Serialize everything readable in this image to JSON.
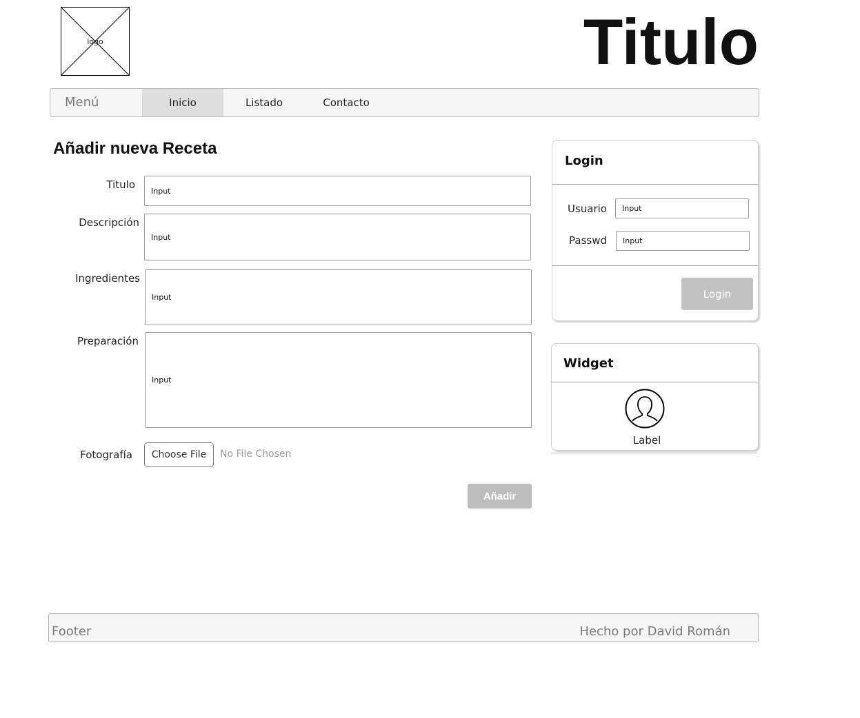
{
  "header": {
    "logo_text": "logo",
    "title": "Titulo"
  },
  "nav": {
    "brand": "Menú",
    "items": [
      {
        "label": "Inicio",
        "active": true
      },
      {
        "label": "Listado",
        "active": false
      },
      {
        "label": "Contacto",
        "active": false
      }
    ]
  },
  "form": {
    "heading": "Añadir nueva Receta",
    "fields": [
      {
        "label": "Titulo",
        "value": "Input"
      },
      {
        "label": "Descripción",
        "value": "Input"
      },
      {
        "label": "Ingredientes",
        "value": "Input"
      },
      {
        "label": "Preparación",
        "value": "Input"
      }
    ],
    "photo": {
      "label": "Fotografía",
      "button": "Choose File",
      "status": "No File Chosen"
    },
    "submit_label": "Añadir"
  },
  "login": {
    "title": "Login",
    "user_label": "Usuario",
    "user_value": "Input",
    "pass_label": "Passwd",
    "pass_value": "Input",
    "button": "Login"
  },
  "widget": {
    "title": "Widget",
    "icon": "user-avatar-icon",
    "label": "Label"
  },
  "footer": {
    "left": "Footer",
    "right": "Hecho por David Román"
  },
  "colors": {
    "nav_bg": "#f6f6f6",
    "nav_active": "#dedede",
    "button_disabled": "#bdbdbd",
    "border": "#b5b5b5"
  }
}
